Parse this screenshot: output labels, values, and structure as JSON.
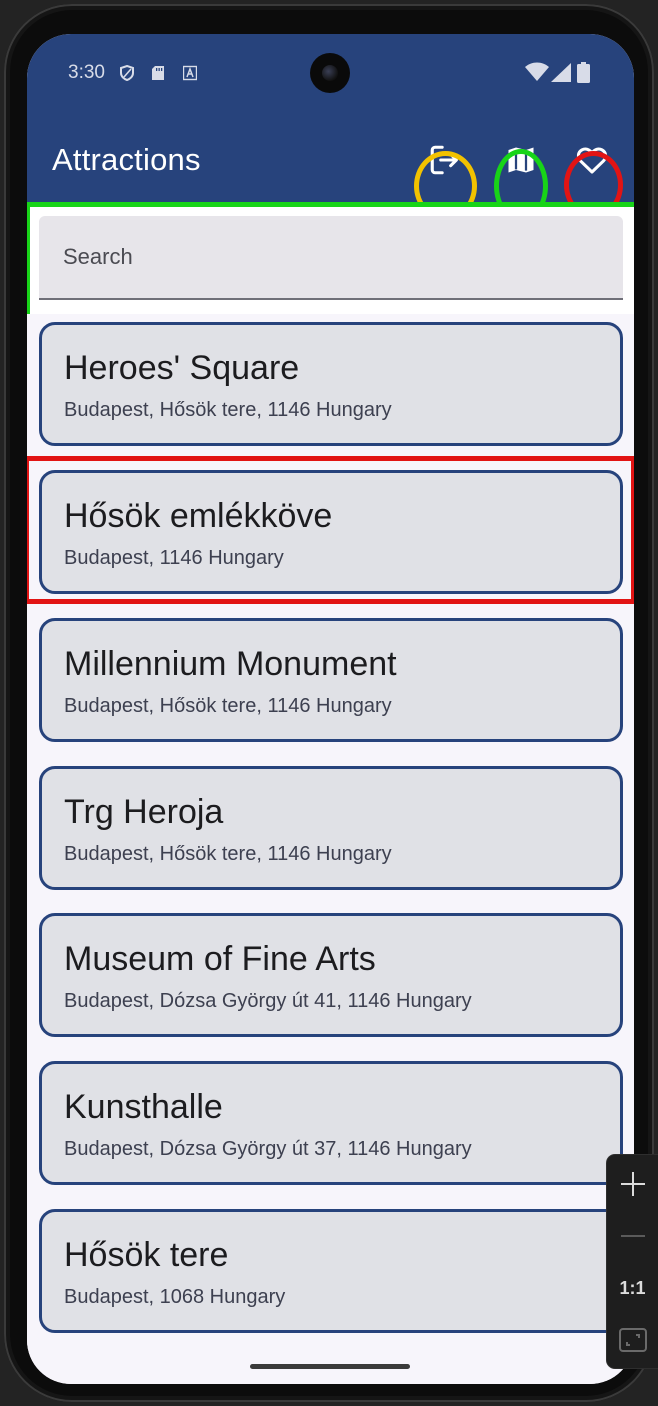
{
  "status_bar": {
    "time": "3:30",
    "icons": [
      "shield-icon",
      "sd-card-icon",
      "text-a-icon",
      "wifi-icon",
      "signal-icon",
      "battery-icon"
    ]
  },
  "app_bar": {
    "title": "Attractions",
    "color": "#27437c",
    "actions": [
      {
        "name": "logout-icon",
        "highlight": "#f2c200"
      },
      {
        "name": "map-icon",
        "highlight": "#18d418"
      },
      {
        "name": "heart-icon",
        "highlight": "#e21414"
      }
    ]
  },
  "search": {
    "placeholder": "Search",
    "value": "",
    "highlight": "#18d418"
  },
  "attractions": [
    {
      "title": "Heroes' Square",
      "address": "Budapest, Hősök tere, 1146 Hungary"
    },
    {
      "title": "Hősök emlékköve",
      "address": "Budapest, 1146 Hungary",
      "highlight": "#e21414"
    },
    {
      "title": "Millennium Monument",
      "address": "Budapest, Hősök tere, 1146 Hungary"
    },
    {
      "title": "Trg Heroja",
      "address": "Budapest, Hősök tere, 1146 Hungary"
    },
    {
      "title": "Museum of Fine Arts",
      "address": "Budapest, Dózsa György út 41, 1146 Hungary"
    },
    {
      "title": "Kunsthalle",
      "address": "Budapest, Dózsa György út 37, 1146 Hungary"
    },
    {
      "title": "Hősök tere",
      "address": "Budapest, 1068 Hungary"
    }
  ],
  "emulator_controls": {
    "items": [
      "zoom-in-icon",
      "zoom-out-icon",
      "actual-size",
      "fit-screen-icon"
    ],
    "actual_size_label": "1:1"
  }
}
